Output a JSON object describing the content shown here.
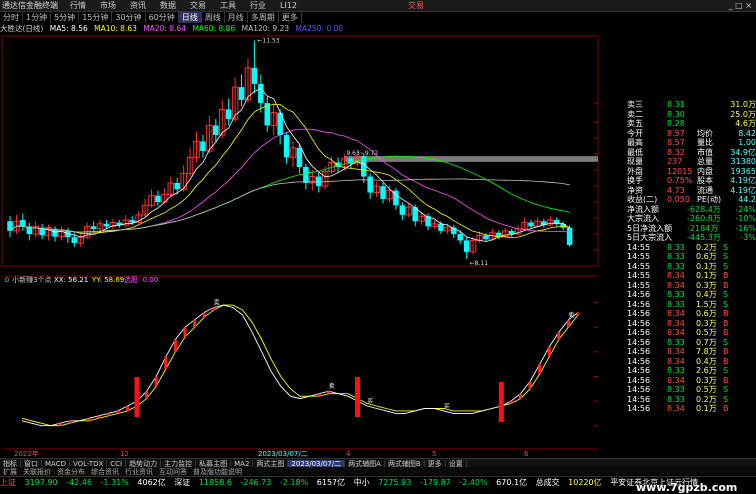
{
  "menubar": {
    "logo": "通达信金融终端",
    "items": [
      "行情",
      "市场",
      "资讯",
      "数据",
      "交易",
      "工具",
      "行业",
      "LI12"
    ],
    "trade": "交易",
    "window_controls": "_ □ ×"
  },
  "period_tabs": [
    {
      "label": "分时",
      "active": false
    },
    {
      "label": "1分钟",
      "active": false
    },
    {
      "label": "5分钟",
      "active": false
    },
    {
      "label": "15分钟",
      "active": false
    },
    {
      "label": "30分钟",
      "active": false
    },
    {
      "label": "60分钟",
      "active": false
    },
    {
      "label": "日线",
      "active": true
    },
    {
      "label": "周线",
      "active": false
    },
    {
      "label": "月线",
      "active": false
    },
    {
      "label": "多周期",
      "active": false
    },
    {
      "label": "更多",
      "active": false
    }
  ],
  "ma_legend": {
    "stock": "大胜达(日线)",
    "ma5": "MA5: 8.56",
    "ma10": "MA10: 8.63",
    "ma20": "MA20: 8.64",
    "ma60": "MA60: 8.86",
    "ma120": "MA120: 9.23",
    "ma250": "MA250: 0.00"
  },
  "chart_data": [
    {
      "type": "candlestick",
      "title": "",
      "price_axis_ticks": [
        "10.55",
        "10.25",
        "10.00",
        "9.75",
        "9.50",
        "9.25",
        "9.00",
        "8.75",
        "8.50",
        "8.25"
      ],
      "ylim": [
        8.0,
        11.6
      ],
      "annotations": [
        "11.53",
        "9.63~9.72",
        "8.11"
      ],
      "x_ticks": [
        "2022年",
        "12",
        "2023/03/07/二",
        "4",
        "5",
        "6"
      ],
      "candles": [
        {
          "o": 8.7,
          "c": 8.55,
          "h": 8.78,
          "l": 8.45
        },
        {
          "o": 8.55,
          "c": 8.7,
          "h": 8.8,
          "l": 8.5
        },
        {
          "o": 8.72,
          "c": 8.62,
          "h": 8.82,
          "l": 8.55
        },
        {
          "o": 8.62,
          "c": 8.5,
          "h": 8.68,
          "l": 8.4
        },
        {
          "o": 8.5,
          "c": 8.62,
          "h": 8.7,
          "l": 8.45
        },
        {
          "o": 8.6,
          "c": 8.48,
          "h": 8.66,
          "l": 8.42
        },
        {
          "o": 8.48,
          "c": 8.6,
          "h": 8.65,
          "l": 8.4
        },
        {
          "o": 8.58,
          "c": 8.46,
          "h": 8.62,
          "l": 8.38
        },
        {
          "o": 8.46,
          "c": 8.55,
          "h": 8.62,
          "l": 8.4
        },
        {
          "o": 8.55,
          "c": 8.45,
          "h": 8.6,
          "l": 8.36
        },
        {
          "o": 8.45,
          "c": 8.36,
          "h": 8.52,
          "l": 8.3
        },
        {
          "o": 8.36,
          "c": 8.45,
          "h": 8.52,
          "l": 8.3
        },
        {
          "o": 8.45,
          "c": 8.62,
          "h": 8.68,
          "l": 8.42
        },
        {
          "o": 8.62,
          "c": 8.58,
          "h": 8.7,
          "l": 8.52
        },
        {
          "o": 8.58,
          "c": 8.66,
          "h": 8.72,
          "l": 8.54
        },
        {
          "o": 8.66,
          "c": 8.62,
          "h": 8.72,
          "l": 8.58
        },
        {
          "o": 8.62,
          "c": 8.68,
          "h": 8.74,
          "l": 8.58
        },
        {
          "o": 8.68,
          "c": 8.64,
          "h": 8.72,
          "l": 8.6
        },
        {
          "o": 8.64,
          "c": 8.72,
          "h": 8.8,
          "l": 8.6
        },
        {
          "o": 8.72,
          "c": 8.68,
          "h": 8.78,
          "l": 8.64
        },
        {
          "o": 8.68,
          "c": 8.8,
          "h": 8.86,
          "l": 8.66
        },
        {
          "o": 8.8,
          "c": 8.95,
          "h": 9.05,
          "l": 8.76
        },
        {
          "o": 8.95,
          "c": 9.1,
          "h": 9.2,
          "l": 8.92
        },
        {
          "o": 9.1,
          "c": 9.0,
          "h": 9.18,
          "l": 8.94
        },
        {
          "o": 9.0,
          "c": 9.12,
          "h": 9.22,
          "l": 8.98
        },
        {
          "o": 9.12,
          "c": 9.3,
          "h": 9.4,
          "l": 9.08
        },
        {
          "o": 9.3,
          "c": 9.2,
          "h": 9.38,
          "l": 9.12
        },
        {
          "o": 9.2,
          "c": 9.45,
          "h": 9.58,
          "l": 9.16
        },
        {
          "o": 9.45,
          "c": 9.7,
          "h": 9.85,
          "l": 9.4
        },
        {
          "o": 9.7,
          "c": 9.95,
          "h": 10.1,
          "l": 9.62
        },
        {
          "o": 9.95,
          "c": 9.8,
          "h": 10.05,
          "l": 9.7
        },
        {
          "o": 9.8,
          "c": 10.2,
          "h": 10.35,
          "l": 9.76
        },
        {
          "o": 10.2,
          "c": 10.05,
          "h": 10.3,
          "l": 9.95
        },
        {
          "o": 10.05,
          "c": 10.45,
          "h": 10.6,
          "l": 10.0
        },
        {
          "o": 10.45,
          "c": 10.3,
          "h": 10.62,
          "l": 10.2
        },
        {
          "o": 10.3,
          "c": 10.8,
          "h": 10.95,
          "l": 10.25
        },
        {
          "o": 10.8,
          "c": 10.6,
          "h": 11.0,
          "l": 10.5
        },
        {
          "o": 10.6,
          "c": 11.1,
          "h": 11.25,
          "l": 10.55
        },
        {
          "o": 11.1,
          "c": 10.85,
          "h": 11.53,
          "l": 10.7
        },
        {
          "o": 10.85,
          "c": 10.55,
          "h": 11.0,
          "l": 10.4
        },
        {
          "o": 10.55,
          "c": 10.2,
          "h": 10.65,
          "l": 10.1
        },
        {
          "o": 10.2,
          "c": 10.4,
          "h": 10.55,
          "l": 10.05
        },
        {
          "o": 10.4,
          "c": 10.05,
          "h": 10.45,
          "l": 9.9
        },
        {
          "o": 10.05,
          "c": 9.7,
          "h": 10.1,
          "l": 9.6
        },
        {
          "o": 9.7,
          "c": 9.85,
          "h": 9.95,
          "l": 9.55
        },
        {
          "o": 9.85,
          "c": 9.55,
          "h": 9.9,
          "l": 9.45
        },
        {
          "o": 9.55,
          "c": 9.3,
          "h": 9.6,
          "l": 9.2
        },
        {
          "o": 9.3,
          "c": 9.4,
          "h": 9.5,
          "l": 9.18
        },
        {
          "o": 9.4,
          "c": 9.25,
          "h": 9.48,
          "l": 9.15
        },
        {
          "o": 9.25,
          "c": 9.48,
          "h": 9.56,
          "l": 9.2
        },
        {
          "o": 9.48,
          "c": 9.62,
          "h": 9.72,
          "l": 9.44
        },
        {
          "o": 9.62,
          "c": 9.55,
          "h": 9.7,
          "l": 9.46
        },
        {
          "o": 9.55,
          "c": 9.68,
          "h": 9.75,
          "l": 9.5
        },
        {
          "o": 9.68,
          "c": 9.6,
          "h": 9.72,
          "l": 9.52
        },
        {
          "o": 9.6,
          "c": 9.72,
          "h": 9.8,
          "l": 9.56
        },
        {
          "o": 9.72,
          "c": 9.4,
          "h": 9.75,
          "l": 9.3
        },
        {
          "o": 9.4,
          "c": 9.15,
          "h": 9.45,
          "l": 9.05
        },
        {
          "o": 9.15,
          "c": 9.25,
          "h": 9.32,
          "l": 9.08
        },
        {
          "o": 9.25,
          "c": 9.05,
          "h": 9.3,
          "l": 8.98
        },
        {
          "o": 9.05,
          "c": 9.18,
          "h": 9.26,
          "l": 9.0
        },
        {
          "o": 9.18,
          "c": 8.95,
          "h": 9.22,
          "l": 8.88
        },
        {
          "o": 8.95,
          "c": 8.8,
          "h": 9.0,
          "l": 8.72
        },
        {
          "o": 8.8,
          "c": 8.92,
          "h": 8.98,
          "l": 8.76
        },
        {
          "o": 8.92,
          "c": 8.7,
          "h": 8.96,
          "l": 8.62
        },
        {
          "o": 8.7,
          "c": 8.78,
          "h": 8.84,
          "l": 8.64
        },
        {
          "o": 8.78,
          "c": 8.62,
          "h": 8.82,
          "l": 8.56
        },
        {
          "o": 8.62,
          "c": 8.66,
          "h": 8.72,
          "l": 8.58
        },
        {
          "o": 8.66,
          "c": 8.55,
          "h": 8.7,
          "l": 8.5
        },
        {
          "o": 8.55,
          "c": 8.6,
          "h": 8.66,
          "l": 8.5
        },
        {
          "o": 8.6,
          "c": 8.5,
          "h": 8.64,
          "l": 8.44
        },
        {
          "o": 8.5,
          "c": 8.4,
          "h": 8.55,
          "l": 8.34
        },
        {
          "o": 8.4,
          "c": 8.22,
          "h": 8.45,
          "l": 8.11
        },
        {
          "o": 8.22,
          "c": 8.4,
          "h": 8.46,
          "l": 8.18
        },
        {
          "o": 8.4,
          "c": 8.48,
          "h": 8.54,
          "l": 8.36
        },
        {
          "o": 8.48,
          "c": 8.42,
          "h": 8.52,
          "l": 8.38
        },
        {
          "o": 8.42,
          "c": 8.52,
          "h": 8.58,
          "l": 8.4
        },
        {
          "o": 8.52,
          "c": 8.46,
          "h": 8.56,
          "l": 8.42
        },
        {
          "o": 8.46,
          "c": 8.55,
          "h": 8.6,
          "l": 8.44
        },
        {
          "o": 8.55,
          "c": 8.5,
          "h": 8.58,
          "l": 8.46
        },
        {
          "o": 8.5,
          "c": 8.58,
          "h": 8.64,
          "l": 8.48
        },
        {
          "o": 8.58,
          "c": 8.68,
          "h": 8.75,
          "l": 8.56
        },
        {
          "o": 8.68,
          "c": 8.62,
          "h": 8.72,
          "l": 8.58
        },
        {
          "o": 8.62,
          "c": 8.7,
          "h": 8.76,
          "l": 8.6
        },
        {
          "o": 8.7,
          "c": 8.64,
          "h": 8.74,
          "l": 8.6
        },
        {
          "o": 8.64,
          "c": 8.72,
          "h": 8.78,
          "l": 8.62
        },
        {
          "o": 8.72,
          "c": 8.66,
          "h": 8.76,
          "l": 8.62
        },
        {
          "o": 8.66,
          "c": 8.6,
          "h": 8.7,
          "l": 8.56
        },
        {
          "o": 8.6,
          "c": 8.33,
          "h": 8.64,
          "l": 8.3
        }
      ]
    },
    {
      "type": "line",
      "title": "小新赚3个点",
      "legend": [
        "XX: 56.21",
        "YY: 58.69",
        "选股: 0.00"
      ],
      "axis_ticks": [
        "60.00",
        "50.00",
        "40.00",
        "30.00",
        "20.00",
        "10.00"
      ],
      "ylim": [
        5,
        70
      ],
      "series": [
        {
          "name": "XX",
          "values": [
            12,
            11,
            10,
            10,
            11,
            12,
            12,
            13,
            14,
            15,
            16,
            18,
            20,
            24,
            30,
            38,
            45,
            50,
            53,
            56,
            58,
            59,
            58,
            55,
            48,
            40,
            32,
            26,
            22,
            21,
            22,
            23,
            24,
            23,
            22,
            20,
            18,
            17,
            16,
            15,
            15,
            16,
            17,
            17,
            16,
            15,
            15,
            15,
            16,
            17,
            18,
            20,
            23,
            28,
            35,
            42,
            48,
            53,
            56
          ]
        },
        {
          "name": "YY",
          "values": [
            13,
            12,
            11,
            10,
            10,
            11,
            12,
            12,
            13,
            14,
            15,
            16,
            18,
            21,
            26,
            33,
            40,
            46,
            50,
            54,
            57,
            59,
            59,
            57,
            52,
            45,
            37,
            30,
            25,
            22,
            22,
            22,
            23,
            23,
            23,
            21,
            19,
            18,
            17,
            16,
            16,
            16,
            17,
            17,
            17,
            16,
            16,
            16,
            16,
            17,
            18,
            19,
            21,
            25,
            31,
            38,
            45,
            50,
            55
          ]
        }
      ],
      "signal_markers": [
        "买",
        "卖"
      ]
    }
  ],
  "right_panel": {
    "rows": [
      {
        "l": "卖三",
        "v": "8.31",
        "v2": "31.0万"
      },
      {
        "l": "卖二",
        "v": "8.30",
        "v2": "25.0万"
      },
      {
        "l": "卖五",
        "v": "8.28",
        "v2": "4.6万"
      },
      {
        "l": "今开",
        "v": "8.57",
        "l2": "均价",
        "v2": "8.42"
      },
      {
        "l": "最高",
        "v": "8.57",
        "l2": "量比",
        "v2": "1.00"
      },
      {
        "l": "最低",
        "v": "8.32",
        "l2": "市值",
        "v2": "34.9亿"
      },
      {
        "l": "现量",
        "v": "237",
        "l2": "总量",
        "v2": "31380"
      },
      {
        "l": "外盘",
        "v": "12015",
        "l2": "内盘",
        "v2": "19365"
      },
      {
        "l": "换手",
        "v": "0.75%",
        "l2": "股本",
        "v2": "4.19亿"
      },
      {
        "l": "净资",
        "v": "4.73",
        "l2": "流通",
        "v2": "4.19亿"
      },
      {
        "l": "收益(二)",
        "v": "0.050",
        "l2": "PE(动)",
        "v2": "44.2"
      }
    ],
    "flows": [
      {
        "l": "净流入额",
        "v": "-628.4万",
        "p": "-24%"
      },
      {
        "l": "大宗流入",
        "v": "-260.8万",
        "p": "-10%"
      },
      {
        "l": "5日净流入额",
        "v": "-2184万",
        "p": "-16%"
      },
      {
        "l": "5日大宗流入",
        "v": "-445.3万",
        "p": "-3%"
      }
    ],
    "ticks": [
      {
        "t": "14:55",
        "p": "8.33",
        "v": "0.2万",
        "s": "S"
      },
      {
        "t": "14:55",
        "p": "8.33",
        "v": "0.6万",
        "s": "S"
      },
      {
        "t": "14:55",
        "p": "8.33",
        "v": "0.1万",
        "s": "S"
      },
      {
        "t": "14:55",
        "p": "8.34",
        "v": "0.1万",
        "s": "B"
      },
      {
        "t": "14:55",
        "p": "8.34",
        "v": "0.3万",
        "s": "B"
      },
      {
        "t": "14:56",
        "p": "8.33",
        "v": "0.4万",
        "s": "S"
      },
      {
        "t": "14:56",
        "p": "8.33",
        "v": "1.5万",
        "s": "S"
      },
      {
        "t": "14:56",
        "p": "8.34",
        "v": "0.6万",
        "s": "B"
      },
      {
        "t": "14:56",
        "p": "8.34",
        "v": "0.3万",
        "s": "B"
      },
      {
        "t": "14:56",
        "p": "8.34",
        "v": "0.5万",
        "s": "B"
      },
      {
        "t": "14:56",
        "p": "8.33",
        "v": "0.7万",
        "s": "S"
      },
      {
        "t": "14:56",
        "p": "8.34",
        "v": "7.8万",
        "s": "B"
      },
      {
        "t": "14:56",
        "p": "8.34",
        "v": "0.4万",
        "s": "B"
      },
      {
        "t": "14:56",
        "p": "8.33",
        "v": "2.6万",
        "s": "S"
      },
      {
        "t": "14:56",
        "p": "8.34",
        "v": "0.3万",
        "s": "B"
      },
      {
        "t": "14:56",
        "p": "8.33",
        "v": "0.5万",
        "s": "S"
      },
      {
        "t": "14:56",
        "p": "8.33",
        "v": "0.2万",
        "s": "S"
      },
      {
        "t": "14:56",
        "p": "8.34",
        "v": "0.1万",
        "s": "B"
      }
    ]
  },
  "bottom_tabs": [
    "指标",
    "窗口",
    "MACD",
    "VOL-TDX",
    "CCI",
    "趋势动力",
    "主力监控",
    "私募主图",
    "MA2",
    "两式主图",
    "2023/03/07/二",
    "两式辅图A",
    "两式辅图B",
    "更多",
    "设置"
  ],
  "extra_bar": [
    "扩展",
    "关联报价",
    "资金分布",
    "综合资讯",
    "行业资讯",
    "互动问答",
    "普及版功能说明"
  ],
  "status": {
    "sh_label": "上证",
    "sh_val": "3197.90",
    "sh_chg": "-42.46",
    "sh_pct": "-1.31%",
    "sh_amt": "4062亿",
    "sz_label": "深证",
    "sz_val": "11858.6",
    "sz_chg": "-246.73",
    "sz_pct": "-2.18%",
    "sz_amt": "6157亿",
    "zx_label": "中小",
    "zx_val": "7275.93",
    "zx_chg": "-179.87",
    "zx_pct": "-2.40%",
    "zx_amt": "670.1亿",
    "total": "总成交",
    "total_val": "10220亿",
    "ticker": "平安证券北京上证云行情"
  },
  "watermark": "www.7gpzb.com"
}
